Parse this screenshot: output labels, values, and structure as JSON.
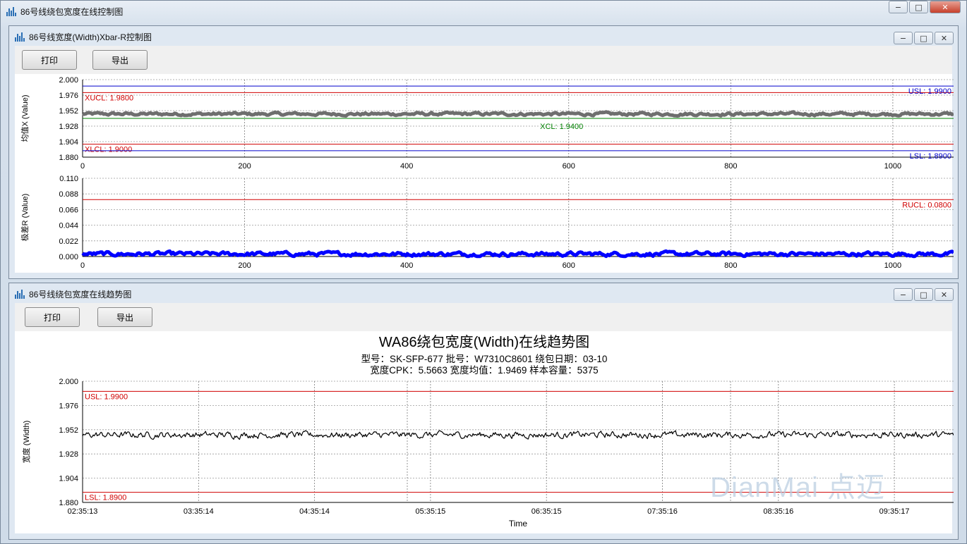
{
  "main_window": {
    "title": "86号线绕包宽度在线控制图"
  },
  "xbar_window": {
    "title": "86号线宽度(Width)Xbar-R控制图",
    "print_label": "打印",
    "export_label": "导出"
  },
  "trend_window": {
    "title": "86号线绕包宽度在线趋势图",
    "print_label": "打印",
    "export_label": "导出"
  },
  "window_buttons": {
    "minimize": "−",
    "maximize": "□",
    "close": "✕"
  },
  "colors": {
    "ucl": "#d00000",
    "spec": "#0000cc",
    "center": "#008000",
    "xbar_series": "#6e6e6e",
    "r_series": "#0000ff",
    "trend_series": "#000000"
  },
  "watermark": "DianMai 点迈",
  "chart_data": [
    {
      "type": "line",
      "name": "xbar",
      "ylabel": "均值X (Value)",
      "xlim": [
        0,
        1075
      ],
      "ylim": [
        1.88,
        2.0
      ],
      "yticks": [
        "2.000",
        "1.976",
        "1.952",
        "1.928",
        "1.904",
        "1.880"
      ],
      "xticks": [
        "0",
        "200",
        "400",
        "600",
        "800",
        "1000"
      ],
      "grid": true,
      "limits": [
        {
          "label": "XUCL: 1.9800",
          "value": 1.98,
          "color": "#d00000",
          "label_side": "left"
        },
        {
          "label": "USL: 1.9900",
          "value": 1.99,
          "color": "#0000cc",
          "label_side": "right"
        },
        {
          "label": "XCL: 1.9400",
          "value": 1.94,
          "color": "#008000",
          "label_side": "center"
        },
        {
          "label": "XLCL: 1.9000",
          "value": 1.9,
          "color": "#d00000",
          "label_side": "left"
        },
        {
          "label": "LSL: 1.8900",
          "value": 1.89,
          "color": "#0000cc",
          "label_side": "right"
        }
      ],
      "series": [
        {
          "mean": 1.9468,
          "spread": 0.0016
        }
      ]
    },
    {
      "type": "line",
      "name": "range",
      "ylabel": "极差R (Value)",
      "xlim": [
        0,
        1075
      ],
      "ylim": [
        0,
        0.11
      ],
      "yticks": [
        "0.110",
        "0.088",
        "0.066",
        "0.044",
        "0.022",
        "0.000"
      ],
      "xticks": [
        "0",
        "200",
        "400",
        "600",
        "800",
        "1000"
      ],
      "grid": true,
      "limits": [
        {
          "label": "RUCL: 0.0800",
          "value": 0.08,
          "color": "#d00000",
          "label_side": "right"
        }
      ],
      "series": [
        {
          "mean": 0.0035,
          "spread": 0.002
        }
      ]
    },
    {
      "type": "line",
      "name": "trend",
      "title": "WA86绕包宽度(Width)在线趋势图",
      "subtitle_1": "型号：SK-SFP-677     批号：W7310C8601     绕包日期：03-10",
      "subtitle_2": "宽度CPK：5.5663     宽度均值：1.9469      样本容量：5375",
      "xlabel": "Time",
      "ylabel": "宽度 (Width)",
      "ylim": [
        1.88,
        2.0
      ],
      "yticks": [
        "2.000",
        "1.976",
        "1.952",
        "1.928",
        "1.904",
        "1.880"
      ],
      "xticks": [
        "02:35:13",
        "03:35:14",
        "04:35:14",
        "05:35:15",
        "06:35:15",
        "07:35:16",
        "08:35:16",
        "09:35:17"
      ],
      "grid": true,
      "limits": [
        {
          "label": "USL: 1.9900",
          "value": 1.99,
          "color": "#d00000",
          "label_side": "left"
        },
        {
          "label": "LSL: 1.8900",
          "value": 1.89,
          "color": "#d00000",
          "label_side": "left"
        }
      ],
      "series": [
        {
          "mean": 1.9469,
          "spread": 0.0022,
          "count": 5375
        }
      ]
    }
  ]
}
